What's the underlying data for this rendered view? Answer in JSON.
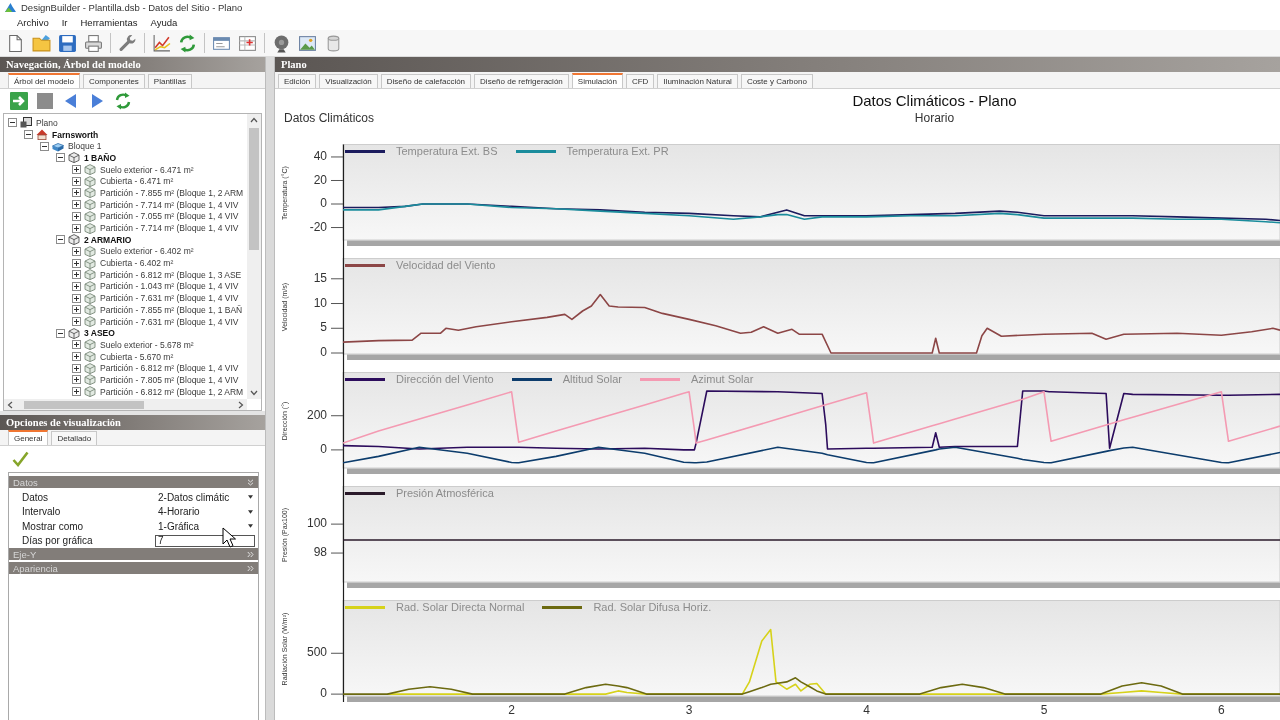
{
  "window": {
    "title": "DesignBuilder - Plantilla.dsb - Datos del Sitio - Plano"
  },
  "menu": [
    {
      "label": "Archivo"
    },
    {
      "label": "Ir"
    },
    {
      "label": "Herramientas"
    },
    {
      "label": "Ayuda"
    }
  ],
  "navigation_panel": {
    "title": "Navegación, Árbol del modelo",
    "tabs": [
      {
        "label": "Árbol del modelo",
        "selected": true
      },
      {
        "label": "Componentes",
        "selected": false
      },
      {
        "label": "Plantillas",
        "selected": false
      }
    ],
    "tree": [
      {
        "label": "Plano",
        "kind": "site",
        "expanded": true,
        "children": [
          {
            "label": "Farnsworth",
            "kind": "building",
            "expanded": true,
            "children": [
              {
                "label": "Bloque 1",
                "kind": "block",
                "expanded": true,
                "children": [
                  {
                    "label": "1 BAÑO",
                    "kind": "zone",
                    "expanded": true,
                    "children": [
                      {
                        "label": "Suelo exterior - 6.471 m²",
                        "kind": "surface",
                        "expanded": false
                      },
                      {
                        "label": "Cubierta - 6.471 m²",
                        "kind": "surface",
                        "expanded": false
                      },
                      {
                        "label": "Partición - 7.855 m² (Bloque 1, 2 ARM",
                        "kind": "surface",
                        "expanded": false
                      },
                      {
                        "label": "Partición - 7.714 m² (Bloque 1, 4 VIV",
                        "kind": "surface",
                        "expanded": false
                      },
                      {
                        "label": "Partición - 7.055 m² (Bloque 1, 4 VIV",
                        "kind": "surface",
                        "expanded": false
                      },
                      {
                        "label": "Partición - 7.714 m² (Bloque 1, 4 VIV",
                        "kind": "surface",
                        "expanded": false
                      }
                    ]
                  },
                  {
                    "label": "2 ARMARIO",
                    "kind": "zone",
                    "expanded": true,
                    "children": [
                      {
                        "label": "Suelo exterior - 6.402 m²",
                        "kind": "surface",
                        "expanded": false
                      },
                      {
                        "label": "Cubierta - 6.402 m²",
                        "kind": "surface",
                        "expanded": false
                      },
                      {
                        "label": "Partición - 6.812 m² (Bloque 1, 3 ASE",
                        "kind": "surface",
                        "expanded": false
                      },
                      {
                        "label": "Partición - 1.043 m² (Bloque 1, 4 VIV",
                        "kind": "surface",
                        "expanded": false
                      },
                      {
                        "label": "Partición - 7.631 m² (Bloque 1, 4 VIV",
                        "kind": "surface",
                        "expanded": false
                      },
                      {
                        "label": "Partición - 7.855 m² (Bloque 1, 1 BAÑ",
                        "kind": "surface",
                        "expanded": false
                      },
                      {
                        "label": "Partición - 7.631 m² (Bloque 1, 4 VIV",
                        "kind": "surface",
                        "expanded": false
                      }
                    ]
                  },
                  {
                    "label": "3 ASEO",
                    "kind": "zone",
                    "expanded": true,
                    "children": [
                      {
                        "label": "Suelo exterior - 5.678 m²",
                        "kind": "surface",
                        "expanded": false
                      },
                      {
                        "label": "Cubierta - 5.670 m²",
                        "kind": "surface",
                        "expanded": false
                      },
                      {
                        "label": "Partición - 6.812 m² (Bloque 1, 4 VIV",
                        "kind": "surface",
                        "expanded": false
                      },
                      {
                        "label": "Partición - 7.805 m² (Bloque 1, 4 VIV",
                        "kind": "surface",
                        "expanded": false
                      },
                      {
                        "label": "Partición - 6.812 m² (Bloque 1, 2 ARM",
                        "kind": "surface",
                        "expanded": false
                      }
                    ]
                  }
                ]
              }
            ]
          }
        ]
      }
    ]
  },
  "options_panel": {
    "title": "Opciones de visualización",
    "tabs": [
      {
        "label": "General",
        "selected": true
      },
      {
        "label": "Detallado",
        "selected": false
      }
    ],
    "sections": [
      {
        "label": "Datos",
        "expanded": true,
        "properties": [
          {
            "label": "Datos",
            "kind": "dropdown",
            "value": "2-Datos climátic"
          },
          {
            "label": "Intervalo",
            "kind": "dropdown",
            "value": "4-Horario"
          },
          {
            "label": "Mostrar como",
            "kind": "dropdown",
            "value": "1-Gráfica"
          },
          {
            "label": "Días por gráfica",
            "kind": "input",
            "value": "7"
          }
        ]
      },
      {
        "label": "Eje-Y",
        "expanded": false
      },
      {
        "label": "Apariencia",
        "expanded": false
      }
    ]
  },
  "main_panel": {
    "title": "Plano",
    "tabs": [
      {
        "label": "Edición",
        "selected": false
      },
      {
        "label": "Visualización",
        "selected": false
      },
      {
        "label": "Diseño de calefacción",
        "selected": false
      },
      {
        "label": "Diseño de refrigeración",
        "selected": false
      },
      {
        "label": "Simulación",
        "selected": true
      },
      {
        "label": "CFD",
        "selected": false
      },
      {
        "label": "Iluminación Natural",
        "selected": false
      },
      {
        "label": "Coste y Carbono",
        "selected": false
      }
    ],
    "report": {
      "title": "Datos Climáticos - Plano",
      "heading": "Datos Climáticos",
      "subtitle": "Horario",
      "charts": [
        {
          "chart_data": {
            "type": "line",
            "ylabel": "Temperatura (°C)",
            "legend": "top left",
            "xlim": [
              1.05,
              6.33
            ],
            "ylim": [
              -30.6,
              50.6
            ],
            "yticks": [
              -20,
              0,
              20,
              40
            ],
            "x": [
              1.05,
              1.25,
              1.4,
              1.5,
              1.75,
              2.0,
              2.25,
              2.5,
              2.75,
              3.0,
              3.25,
              3.4,
              3.5,
              3.55,
              3.65,
              3.75,
              4.0,
              4.25,
              4.5,
              4.75,
              4.85,
              5.0,
              5.25,
              5.5,
              5.75,
              6.0,
              6.25,
              6.33
            ],
            "series": [
              {
                "name": "Temperatura Ext. BS",
                "color": "#1c1c5e",
                "values": [
                  -3,
                  -3,
                  -2,
                  0,
                  0,
                  -2,
                  -4,
                  -5,
                  -7,
                  -8,
                  -10,
                  -11,
                  -7,
                  -5,
                  -10,
                  -10,
                  -10,
                  -9,
                  -8,
                  -6,
                  -7,
                  -10,
                  -10,
                  -10,
                  -11,
                  -12,
                  -13,
                  -14
                ]
              },
              {
                "name": "Temperatura Ext. PR",
                "color": "#1a8c9c",
                "values": [
                  -5,
                  -5,
                  -2,
                  0,
                  0,
                  -3,
                  -4,
                  -6,
                  -8,
                  -10,
                  -13,
                  -11,
                  -9,
                  -9,
                  -13,
                  -11,
                  -11,
                  -10,
                  -10,
                  -8,
                  -9,
                  -12,
                  -12,
                  -12,
                  -13,
                  -13,
                  -15,
                  -16
                ]
              }
            ]
          }
        },
        {
          "chart_data": {
            "type": "line",
            "ylabel": "Velocidad (m/s)",
            "legend": "top left",
            "xlim": [
              1.05,
              6.33
            ],
            "ylim": [
              -0.2,
              19.1
            ],
            "yticks": [
              0,
              5,
              10,
              15
            ],
            "x": [
              1.05,
              1.25,
              1.44,
              1.49,
              1.6,
              1.63,
              1.7,
              1.8,
              2.0,
              2.2,
              2.3,
              2.34,
              2.4,
              2.45,
              2.5,
              2.55,
              2.6,
              2.75,
              2.85,
              3.0,
              3.15,
              3.29,
              3.35,
              3.42,
              3.5,
              3.58,
              3.62,
              3.75,
              3.8,
              4.0,
              4.37,
              4.39,
              4.41,
              4.62,
              4.65,
              4.68,
              4.76,
              5.0,
              5.27,
              5.35,
              5.45,
              5.75,
              6.0,
              6.17,
              6.29,
              6.33
            ],
            "series": [
              {
                "name": "Velocidad del Viento",
                "color": "#8c4646",
                "values": [
                  2.2,
                  2.5,
                  2.6,
                  4,
                  4,
                  5,
                  4.6,
                  5.3,
                  6.3,
                  7.2,
                  7.8,
                  6.8,
                  8.5,
                  9.5,
                  11.8,
                  9.5,
                  9.3,
                  9.2,
                  8,
                  6.8,
                  5.5,
                  4,
                  4.2,
                  5.3,
                  4,
                  4.8,
                  3.8,
                  3.8,
                  0,
                  0,
                  0,
                  3,
                  0,
                  0,
                  3.5,
                  5,
                  3.4,
                  3.8,
                  4,
                  2.8,
                  3.8,
                  4,
                  3.6,
                  4.3,
                  5,
                  4.6
                ]
              }
            ]
          }
        },
        {
          "chart_data": {
            "type": "line",
            "ylabel": "Dirección (°)",
            "legend": "top left",
            "xlim": [
              1.05,
              6.33
            ],
            "ylim": [
              -106,
              453
            ],
            "yticks": [
              0,
              200
            ],
            "x": [
              1.05,
              1.25,
              1.48,
              1.75,
              2.0,
              2.03,
              2.04,
              2.25,
              2.49,
              2.75,
              2.97,
              3.0,
              3.03,
              3.04,
              3.1,
              3.5,
              3.75,
              3.77,
              3.78,
              4.0,
              4.03,
              4.04,
              4.37,
              4.39,
              4.41,
              4.5,
              4.85,
              4.88,
              5.0,
              5.03,
              5.04,
              5.35,
              5.37,
              5.45,
              5.5,
              6.0,
              6.03,
              6.04,
              6.33
            ],
            "series": [
              {
                "name": "Dirección del Viento",
                "color": "#2c0c5c",
                "values": [
                  25,
                  20,
                  5,
                  15,
                  15,
                  15,
                  15,
                  10,
                  5,
                  10,
                  0,
                  0,
                  0,
                  40,
                  345,
                  340,
                  330,
                  150,
                  5,
                  10,
                  10,
                  10,
                  15,
                  100,
                  15,
                  20,
                  20,
                  345,
                  345,
                  340,
                  340,
                  330,
                  10,
                  330,
                  325,
                  320,
                  320,
                  320,
                  325
                ]
              },
              {
                "name": "Altitud Solar",
                "color": "#0c3c6c",
                "values": [
                  -75,
                  -38,
                  15,
                  -20,
                  -74,
                  -75,
                  -75,
                  -38,
                  16,
                  -20,
                  -72,
                  -74,
                  -75,
                  -75,
                  -71,
                  16,
                  -20,
                  -26,
                  -29,
                  -74,
                  -75,
                  -75,
                  -4,
                  0,
                  5,
                  16,
                  -49,
                  -56,
                  -74,
                  -75,
                  -75,
                  -9,
                  -4,
                  11,
                  16,
                  -74,
                  -75,
                  -75,
                  -15
                ]
              },
              {
                "name": "Azimut Solar",
                "color": "#f49ab2",
                "values": [
                  40,
                  110,
                  180,
                  263,
                  340,
                  119,
                  45,
                  110,
                  183,
                  263,
                  331,
                  340,
                  119,
                  40,
                  58,
                  180,
                  258,
                  264,
                  267,
                  335,
                  119,
                  40,
                  141,
                  147,
                  153,
                  180,
                  288,
                  297,
                  340,
                  119,
                  50,
                  145,
                  151,
                  176,
                  191,
                  340,
                  119,
                  50,
                  139
                ]
              }
            ]
          }
        },
        {
          "chart_data": {
            "type": "line",
            "ylabel": "Presión (Pax100)",
            "legend": "top left",
            "xlim": [
              1.05,
              6.33
            ],
            "ylim": [
              96.0,
              102.6
            ],
            "yticks": [
              98,
              100
            ],
            "x": [
              1.05,
              6.33
            ],
            "series": [
              {
                "name": "Presión Atmosférica",
                "color": "#2a1a2a",
                "values": [
                  98.9,
                  98.9
                ]
              }
            ]
          }
        },
        {
          "chart_data": {
            "type": "line",
            "ylabel": "Radiación Solar (W/m²)",
            "legend": "top left",
            "xlim": [
              1.05,
              6.33
            ],
            "ylim": [
              -23,
              1146
            ],
            "yticks": [
              0,
              500
            ],
            "xticks": [
              2,
              3,
              4,
              5,
              6
            ],
            "x": [
              1.05,
              1.3,
              1.42,
              1.54,
              1.66,
              1.78,
              2.3,
              2.42,
              2.53,
              2.6,
              2.65,
              2.76,
              3.3,
              3.34,
              3.41,
              3.46,
              3.49,
              3.55,
              3.6,
              3.63,
              3.68,
              3.72,
              3.77,
              3.84,
              4.3,
              4.42,
              4.54,
              4.66,
              4.78,
              5.32,
              5.44,
              5.55,
              5.66,
              5.78,
              6.33
            ],
            "series": [
              {
                "name": "Rad. Solar Directa Normal",
                "color": "#d6d21a",
                "values": [
                  null,
                  0,
                  0,
                  0,
                  0,
                  0,
                  0,
                  0,
                  0,
                  40,
                  20,
                  0,
                  0,
                  150,
                  650,
                  790,
                  150,
                  60,
                  120,
                  40,
                  120,
                  130,
                  0,
                  0,
                  0,
                  0,
                  0,
                  0,
                  0,
                  0,
                  20,
                  40,
                  20,
                  0,
                  0
                ]
              },
              {
                "name": "Rad. Solar Difusa Horiz.",
                "color": "#6c6a10",
                "values": [
                  0,
                  0,
                  60,
                  90,
                  60,
                  0,
                  0,
                  80,
                  120,
                  100,
                  80,
                  0,
                  0,
                  30,
                  80,
                  120,
                  130,
                  150,
                  200,
                  150,
                  90,
                  40,
                  0,
                  0,
                  0,
                  80,
                  120,
                  80,
                  0,
                  0,
                  100,
                  140,
                  100,
                  0,
                  0
                ]
              }
            ]
          }
        }
      ]
    }
  }
}
